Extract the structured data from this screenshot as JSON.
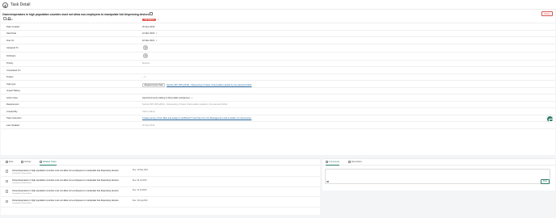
{
  "header": {
    "title": "Task Detail"
  },
  "task": {
    "title": "Owners/operators in high population counties must not allow non-employees to manipulate fuel dispensing devices",
    "delete_label": "Delete"
  },
  "fields": [
    {
      "label": "Status",
      "value": "Not Started",
      "kind": "status"
    },
    {
      "label": "Date Created",
      "value": "25 Sep 2019"
    },
    {
      "label": "Start Date",
      "value": "24 Mar 2018",
      "kind": "caret"
    },
    {
      "label": "Due On",
      "value": "18 Mar 2019",
      "kind": "caret"
    },
    {
      "label": "Assigned To",
      "kind": "avatar"
    },
    {
      "label": "Followers",
      "kind": "avatar"
    },
    {
      "label": "Priority",
      "value": "Medium",
      "kind": "muted"
    },
    {
      "label": "Completed On",
      "value": ""
    },
    {
      "label": "Project",
      "value": "-",
      "kind": "caret"
    },
    {
      "label": "Task type",
      "value": "Section 807.305 (2019) - Dispensing of Class I Flammable Liquids by the General Public",
      "button": "Requirements Task",
      "kind": "tasktype"
    },
    {
      "label": "Impact Rating",
      "value": ""
    },
    {
      "label": "Action Area",
      "value": "Apportionments relating to flammable substances",
      "kind": "caret"
    },
    {
      "label": "Requirement",
      "value": "Section 807.305 (2019) - Dispensing of Class I Flammable Liquids by the General Public",
      "kind": "muted"
    },
    {
      "label": "Created By",
      "value": "Citizen Ethos",
      "kind": "muted"
    },
    {
      "label": "Task Instruction",
      "value": "Create survey of this Task and assign to all Branch? Get help from the Management and to attach our documents.",
      "kind": "link"
    },
    {
      "label": "Last Updated",
      "value": "25 Sep 2019",
      "kind": "muted"
    }
  ],
  "left_tabs": [
    {
      "label": "Files",
      "icon": "file-icon"
    },
    {
      "label": "Activity",
      "icon": "activity-icon"
    },
    {
      "label": "Related Tasks",
      "icon": "related-icon",
      "active": true
    }
  ],
  "right_tabs": [
    {
      "label": "Comments",
      "icon": "comment-icon",
      "active": true
    },
    {
      "label": "Reminders",
      "icon": "bell-icon"
    }
  ],
  "related_tasks": [
    {
      "title": "Owners/operators in high population counties must not allow non-employees to manipulate fuel dispensing devices",
      "subtitle": "Created by Citizen Ethos",
      "date": "Due: 14 May 2019"
    },
    {
      "title": "Owners/operators in high population counties must not allow non-employees to manipulate fuel dispensing devices",
      "subtitle": "Created by Citizen Ethos",
      "date": "Due: 09 Jul 2019"
    },
    {
      "title": "Owners/operators in high population counties must not allow non-employees to manipulate fuel dispensing devices",
      "subtitle": "Created by Citizen Ethos",
      "date": "Due: 12 Jul 2019"
    },
    {
      "title": "Owners/operators in high population counties must not allow non-employees to manipulate fuel dispensing devices",
      "subtitle": "Created by Citizen Ethos",
      "date": "Due: 16 Aug 2019"
    }
  ],
  "comments": {
    "post_label": "Post"
  },
  "colors": {
    "accent": "#2e7d6b",
    "status_red": "#e05a4f",
    "danger": "#d9534f"
  }
}
